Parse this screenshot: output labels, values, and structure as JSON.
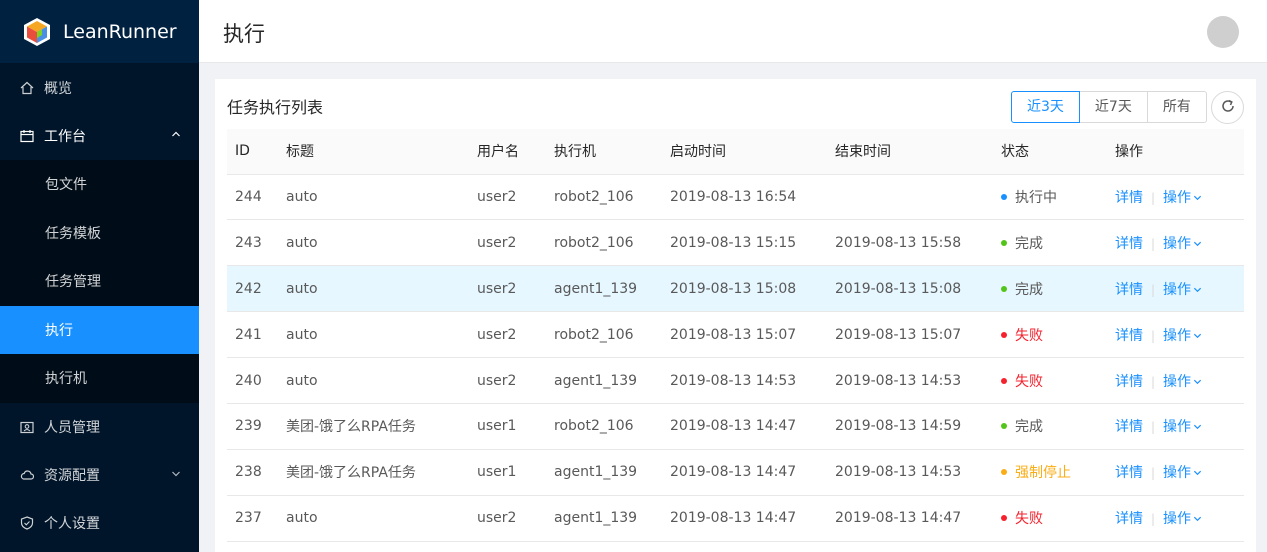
{
  "app": {
    "name": "LeanRunner"
  },
  "sidebar": {
    "items": [
      {
        "label": "概览",
        "icon": "home-icon"
      },
      {
        "label": "工作台",
        "icon": "calendar-icon",
        "open": true,
        "children": [
          {
            "label": "包文件"
          },
          {
            "label": "任务模板"
          },
          {
            "label": "任务管理"
          },
          {
            "label": "执行",
            "active": true
          },
          {
            "label": "执行机"
          }
        ]
      },
      {
        "label": "人员管理",
        "icon": "contacts-icon"
      },
      {
        "label": "资源配置",
        "icon": "cloud-icon"
      },
      {
        "label": "个人设置",
        "icon": "shield-icon"
      }
    ]
  },
  "header": {
    "title": "执行"
  },
  "card": {
    "title": "任务执行列表",
    "ranges": [
      "近3天",
      "近7天",
      "所有"
    ],
    "active_range": "近3天"
  },
  "table": {
    "columns": [
      "ID",
      "标题",
      "用户名",
      "执行机",
      "启动时间",
      "结束时间",
      "状态",
      "操作"
    ],
    "detail_label": "详情",
    "ops_label": "操作",
    "rows": [
      {
        "id": "244",
        "title": "auto",
        "user": "user2",
        "machine": "robot2_106",
        "start": "2019-08-13 16:54",
        "end": "",
        "status": "执行中",
        "status_color": "#1890ff",
        "text_color": "#595959"
      },
      {
        "id": "243",
        "title": "auto",
        "user": "user2",
        "machine": "robot2_106",
        "start": "2019-08-13 15:15",
        "end": "2019-08-13 15:58",
        "status": "完成",
        "status_color": "#52c41a",
        "text_color": "#595959"
      },
      {
        "id": "242",
        "title": "auto",
        "user": "user2",
        "machine": "agent1_139",
        "start": "2019-08-13 15:08",
        "end": "2019-08-13 15:08",
        "status": "完成",
        "status_color": "#52c41a",
        "text_color": "#595959"
      },
      {
        "id": "241",
        "title": "auto",
        "user": "user2",
        "machine": "robot2_106",
        "start": "2019-08-13 15:07",
        "end": "2019-08-13 15:07",
        "status": "失败",
        "status_color": "#f5222d",
        "text_color": "#f5222d"
      },
      {
        "id": "240",
        "title": "auto",
        "user": "user2",
        "machine": "agent1_139",
        "start": "2019-08-13 14:53",
        "end": "2019-08-13 14:53",
        "status": "失败",
        "status_color": "#f5222d",
        "text_color": "#f5222d"
      },
      {
        "id": "239",
        "title": "美团-饿了么RPA任务",
        "user": "user1",
        "machine": "robot2_106",
        "start": "2019-08-13 14:47",
        "end": "2019-08-13 14:59",
        "status": "完成",
        "status_color": "#52c41a",
        "text_color": "#595959"
      },
      {
        "id": "238",
        "title": "美团-饿了么RPA任务",
        "user": "user1",
        "machine": "agent1_139",
        "start": "2019-08-13 14:47",
        "end": "2019-08-13 14:53",
        "status": "强制停止",
        "status_color": "#faad14",
        "text_color": "#faad14"
      },
      {
        "id": "237",
        "title": "auto",
        "user": "user2",
        "machine": "agent1_139",
        "start": "2019-08-13 14:47",
        "end": "2019-08-13 14:47",
        "status": "失败",
        "status_color": "#f5222d",
        "text_color": "#f5222d"
      }
    ],
    "highlight_id": "242"
  }
}
